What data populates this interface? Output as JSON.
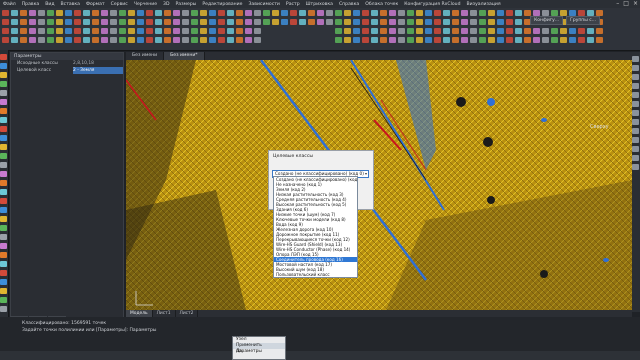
{
  "menubar": [
    "Файл",
    "Правка",
    "Вид",
    "Вставка",
    "Формат",
    "Сервис",
    "Черчение",
    "3D",
    "Размеры",
    "Редактирование",
    "Зависимости",
    "Растр",
    "Штриховка",
    "Справка",
    "Облака точек",
    "Конфигурация RxCloud",
    "Визуализация"
  ],
  "ribbon": {
    "combo1": "Конфигу...",
    "combo2": "Группы с..."
  },
  "panel": {
    "title": "Параметры",
    "rows": [
      {
        "k": "Исходные классы",
        "v": "2,8,10,18"
      },
      {
        "k": "Целевой класс",
        "v": "2 - Земля"
      }
    ]
  },
  "viewport": {
    "tabs": [
      "Без имени",
      "Без имени*"
    ],
    "label": "Сверху"
  },
  "bottom_tabs": [
    "Модель",
    "Лист1",
    "Лист2"
  ],
  "dialog": {
    "title": "Целевые классы",
    "selected": "Создано (не классифицировано) (код 0)",
    "options": [
      "Создано (не классифицировано) (код 0)",
      "Не назначено (код 1)",
      "Земля (код 2)",
      "Низкая растительность (код 3)",
      "Средняя растительность (код 4)",
      "Высокая растительность (код 5)",
      "Здания (код 6)",
      "Низкие точки (шум) (код 7)",
      "Ключевые точки модели (код 8)",
      "Вода (код 9)",
      "Железная дорога (код 10)",
      "Дорожное покрытие (код 11)",
      "Перекрывающиеся точки (код 12)",
      "Wire-HS Guard (Shield) (код 13)",
      "Wire-HS Conductor (Phase) (код 14)",
      "Опора ЛЭП (код 15)",
      "Соединитель провода (код 16)",
      "Мостовой настил (код 17)",
      "Высокий шум (код 18)",
      "Пользовательский класс"
    ],
    "highlighted_index": 16
  },
  "cmdline": [
    "Классифицировано: 1569591 точек",
    "Задайте точки полилинии или [Параметры]: Параметры"
  ],
  "menu_popup": {
    "header": "Узел",
    "items": [
      "Применить параметры",
      "Да"
    ]
  },
  "colors": {
    "points": "#d9b41e",
    "ground": "#2f6fd6",
    "wire": "#c8141e",
    "accent": "#3a6fb2"
  }
}
